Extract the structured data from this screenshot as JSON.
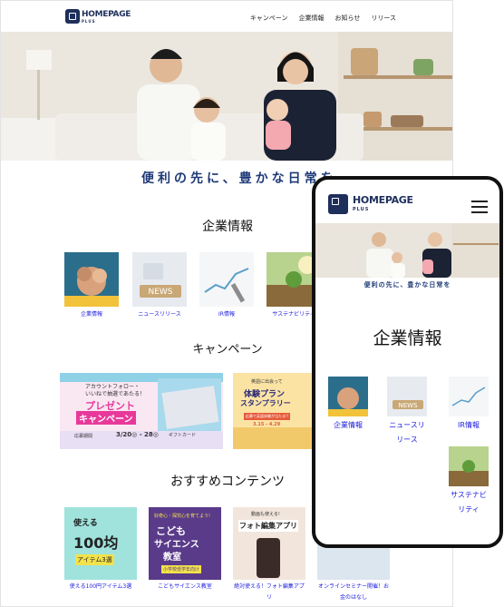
{
  "desktop": {
    "logo": {
      "name": "HOMEPAGE",
      "sub": "PLUS"
    },
    "nav": [
      "キャンペーン",
      "企業情報",
      "お知らせ",
      "リリース"
    ],
    "tagline": "便利の先に、豊かな日常を",
    "company_section": {
      "title": "企業情報",
      "items": [
        "企業情報",
        "ニュースリリース",
        "IR情報",
        "サステナビリティ"
      ]
    },
    "campaign_section": {
      "title": "キャンペーン",
      "banner1": {
        "line1": "アカウントフォロー・",
        "line2": "いいねで抽選であたる！",
        "line3": "プレゼント",
        "line4": "キャンペーン",
        "period": "応募期間",
        "dates": "3/20◎ - 28◎",
        "gift": "ギフトカード"
      },
      "banner2": {
        "line1": "英語に出会って",
        "line2": "体験プラン",
        "line3": "スタンプラリー",
        "line4": "応募で英語体験が当たる!!",
        "dates": "3.15 - 4.29"
      }
    },
    "recommend_section": {
      "title": "おすすめコンテンツ",
      "items": [
        {
          "label": "使える100円アイテム3選",
          "thumb_lines": [
            "使える",
            "100均",
            "アイテム3選"
          ]
        },
        {
          "label": "こどもサイエンス教室",
          "thumb_lines": [
            "こども",
            "サイエンス",
            "教室",
            "好奇心・探究心を育てよう!",
            "小学校低学年向け"
          ]
        },
        {
          "label": "絶対使える！フォト編集アプリ",
          "thumb_lines": [
            "動画も使える!",
            "フォト編集アプリ"
          ]
        },
        {
          "label": "オンラインセミナー開催！お金のはなし",
          "thumb_lines": []
        }
      ]
    }
  },
  "mobile": {
    "logo": {
      "name": "HOMEPAGE",
      "sub": "PLUS"
    },
    "tagline": "便利の先に、豊かな日常を",
    "section_title": "企業情報",
    "items": [
      "企業情報",
      "ニュースリリース",
      "IR情報",
      "サステナビリティ"
    ]
  }
}
